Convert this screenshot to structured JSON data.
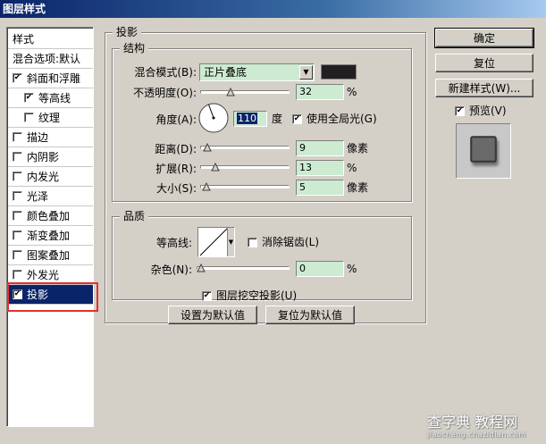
{
  "window": {
    "title": "图层样式"
  },
  "style_list": {
    "items": [
      {
        "label": "样式",
        "checkbox": false,
        "checked": false,
        "indent": false,
        "selected": false
      },
      {
        "label": "混合选项:默认",
        "checkbox": false,
        "checked": false,
        "indent": false,
        "selected": false
      },
      {
        "label": "斜面和浮雕",
        "checkbox": true,
        "checked": true,
        "indent": false,
        "selected": false
      },
      {
        "label": "等高线",
        "checkbox": true,
        "checked": true,
        "indent": true,
        "selected": false
      },
      {
        "label": "纹理",
        "checkbox": true,
        "checked": false,
        "indent": true,
        "selected": false
      },
      {
        "label": "描边",
        "checkbox": true,
        "checked": false,
        "indent": false,
        "selected": false
      },
      {
        "label": "内阴影",
        "checkbox": true,
        "checked": false,
        "indent": false,
        "selected": false
      },
      {
        "label": "内发光",
        "checkbox": true,
        "checked": false,
        "indent": false,
        "selected": false
      },
      {
        "label": "光泽",
        "checkbox": true,
        "checked": false,
        "indent": false,
        "selected": false
      },
      {
        "label": "颜色叠加",
        "checkbox": true,
        "checked": false,
        "indent": false,
        "selected": false
      },
      {
        "label": "渐变叠加",
        "checkbox": true,
        "checked": false,
        "indent": false,
        "selected": false
      },
      {
        "label": "图案叠加",
        "checkbox": true,
        "checked": false,
        "indent": false,
        "selected": false
      },
      {
        "label": "外发光",
        "checkbox": true,
        "checked": false,
        "indent": false,
        "selected": false
      },
      {
        "label": "投影",
        "checkbox": true,
        "checked": true,
        "indent": false,
        "selected": true
      }
    ]
  },
  "drop_shadow": {
    "title": "投影",
    "structure": {
      "title": "结构",
      "blend_mode": {
        "label": "混合模式(B):",
        "value": "正片叠底",
        "color": "#231f20"
      },
      "opacity": {
        "label": "不透明度(O):",
        "value": "32",
        "unit": "%",
        "fraction": 0.32
      },
      "angle": {
        "label": "角度(A):",
        "value": "110",
        "unit": "度"
      },
      "use_global_light": {
        "label": "使用全局光(G)",
        "checked": true
      },
      "distance": {
        "label": "距离(D):",
        "value": "9",
        "unit": "像素",
        "fraction": 0.03
      },
      "spread": {
        "label": "扩展(R):",
        "value": "13",
        "unit": "%",
        "fraction": 0.13
      },
      "size": {
        "label": "大小(S):",
        "value": "5",
        "unit": "像素",
        "fraction": 0.02
      }
    },
    "quality": {
      "title": "品质",
      "contour": {
        "label": "等高线:"
      },
      "anti_aliased": {
        "label": "消除锯齿(L)",
        "checked": false
      },
      "noise": {
        "label": "杂色(N):",
        "value": "0",
        "unit": "%",
        "fraction": 0.0
      }
    },
    "knockout": {
      "label": "图层挖空投影(U)",
      "checked": true
    },
    "buttons": {
      "make_default": "设置为默认值",
      "reset_default": "复位为默认值"
    }
  },
  "side_buttons": {
    "ok": "确定",
    "reset": "复位",
    "new_style": "新建样式(W)...",
    "preview": {
      "label": "预览(V)",
      "checked": true
    }
  },
  "watermark": {
    "line1": "查字典 教程网",
    "line2": "jiaocheng.chazidian.com"
  },
  "colors": {
    "accent": "#0a246a",
    "input_bg": "#ccebd1",
    "highlight": "#e53030"
  }
}
